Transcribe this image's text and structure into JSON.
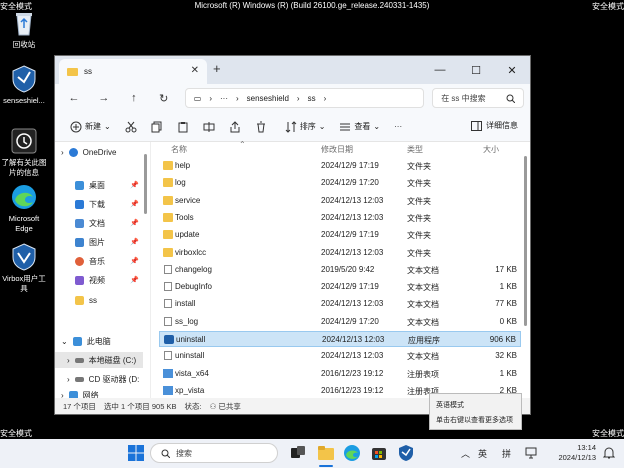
{
  "safe_mode": "安全模式",
  "os_title": "Microsoft (R) Windows (R) (Build 26100.ge_release.240331-1435)",
  "desktop_icons": [
    {
      "label": "回收站",
      "icon": "recycle-bin-icon"
    },
    {
      "label": "senseshiel...",
      "icon": "senseshield-icon"
    },
    {
      "label": "了解有关此图片的信息",
      "icon": "info-icon"
    },
    {
      "label": "Microsoft Edge",
      "icon": "edge-icon"
    },
    {
      "label": "Virbox用户工具",
      "icon": "virbox-icon"
    }
  ],
  "window": {
    "tab_title": "ss",
    "new_tab": "+",
    "controls": {
      "minimize": "—",
      "maximize": "☐",
      "close": "✕"
    },
    "breadcrumb": [
      "senseshield",
      "ss"
    ],
    "search_placeholder": "在 ss 中搜索",
    "toolbar": {
      "new": "新建",
      "sort": "排序",
      "view": "查看",
      "more": "···",
      "details": "详细信息"
    },
    "sidebar": {
      "onedrive": "OneDrive",
      "quick": [
        {
          "label": "桌面",
          "color": "#3c8fd9"
        },
        {
          "label": "下载",
          "color": "#2b7ad6"
        },
        {
          "label": "文档",
          "color": "#4b8ad3"
        },
        {
          "label": "图片",
          "color": "#3d83cf"
        },
        {
          "label": "音乐",
          "color": "#e0603a"
        },
        {
          "label": "视频",
          "color": "#7f5bd0"
        },
        {
          "label": "ss",
          "color": "#f3c449"
        }
      ],
      "this_pc": "此电脑",
      "local_disk": "本地磁盘 (C:)",
      "cd_drive": "CD 驱动器 (D:",
      "network": "网络"
    },
    "columns": {
      "name": "名称",
      "date": "修改日期",
      "type": "类型",
      "size": "大小"
    },
    "files": [
      {
        "name": "help",
        "date": "2024/12/9 17:19",
        "type": "文件夹",
        "size": "",
        "kind": "folder"
      },
      {
        "name": "log",
        "date": "2024/12/9 17:20",
        "type": "文件夹",
        "size": "",
        "kind": "folder"
      },
      {
        "name": "service",
        "date": "2024/12/13 12:03",
        "type": "文件夹",
        "size": "",
        "kind": "folder"
      },
      {
        "name": "Tools",
        "date": "2024/12/13 12:03",
        "type": "文件夹",
        "size": "",
        "kind": "folder"
      },
      {
        "name": "update",
        "date": "2024/12/9 17:19",
        "type": "文件夹",
        "size": "",
        "kind": "folder"
      },
      {
        "name": "virboxlcc",
        "date": "2024/12/13 12:03",
        "type": "文件夹",
        "size": "",
        "kind": "folder"
      },
      {
        "name": "changelog",
        "date": "2019/5/20 9:42",
        "type": "文本文档",
        "size": "17 KB",
        "kind": "doc"
      },
      {
        "name": "DebugInfo",
        "date": "2024/12/9 17:19",
        "type": "文本文档",
        "size": "1 KB",
        "kind": "doc"
      },
      {
        "name": "install",
        "date": "2024/12/13 12:03",
        "type": "文本文档",
        "size": "77 KB",
        "kind": "doc"
      },
      {
        "name": "ss_log",
        "date": "2024/12/9 17:20",
        "type": "文本文档",
        "size": "0 KB",
        "kind": "doc"
      },
      {
        "name": "uninstall",
        "date": "2024/12/13 12:03",
        "type": "应用程序",
        "size": "906 KB",
        "kind": "app",
        "selected": true
      },
      {
        "name": "uninstall",
        "date": "2024/12/13 12:03",
        "type": "文本文档",
        "size": "32 KB",
        "kind": "doc"
      },
      {
        "name": "vista_x64",
        "date": "2016/12/23 19:12",
        "type": "注册表项",
        "size": "1 KB",
        "kind": "reg"
      },
      {
        "name": "xp_vista",
        "date": "2016/12/23 19:12",
        "type": "注册表项",
        "size": "2 KB",
        "kind": "reg"
      }
    ],
    "status": {
      "count": "17 个项目",
      "selected": "选中 1 个项目  905 KB",
      "state_label": "状态:",
      "state": "已共享"
    }
  },
  "popup": {
    "line1": "英语模式",
    "line2": "单击右键以查看更多选项"
  },
  "taskbar": {
    "search": "搜索",
    "ime_lang": "英",
    "ime_mode": "拼",
    "time": "13:14",
    "date": "2024/12/13"
  }
}
